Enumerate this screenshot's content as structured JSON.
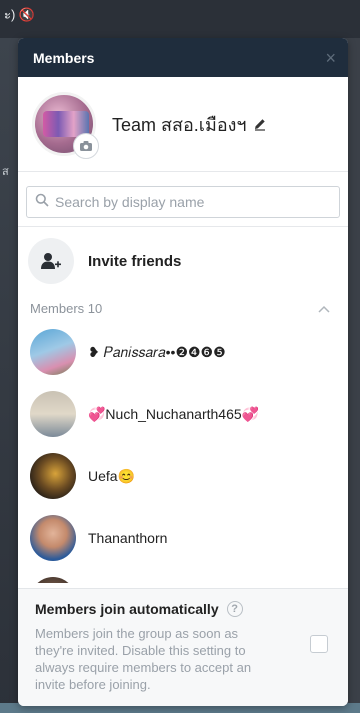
{
  "background": {
    "system_icons": "ะ) 🔇",
    "side_text": "ส"
  },
  "modal": {
    "title": "Members",
    "close_glyph": "×",
    "group": {
      "name": "Team สสอ.เมืองฯ"
    },
    "search": {
      "placeholder": "Search by display name",
      "value": ""
    },
    "invite": {
      "label": "Invite friends"
    },
    "members_header": "Members 10",
    "members": [
      {
        "name": "❥ 𝑃𝑎𝑛𝑖𝑠𝑠𝑎𝑟𝑎••❷❹❻❺",
        "avatar_colors": [
          "#5aa6d6",
          "#d98fb0"
        ]
      },
      {
        "name": "💞Nuch_Nuchanarth465💞",
        "avatar_colors": [
          "#c9c2b4",
          "#7c8a99"
        ]
      },
      {
        "name": "Uefa😊",
        "avatar_colors": [
          "#1e1a17",
          "#d8a33a"
        ]
      },
      {
        "name": "Thananthorn",
        "avatar_colors": [
          "#2b5a9a",
          "#e2b49a"
        ]
      },
      {
        "name": "",
        "avatar_colors": [
          "#3a2d27",
          "#8a6b55"
        ]
      }
    ],
    "auto_join": {
      "title": "Members join automatically",
      "help_glyph": "?",
      "description": "Members join the group as soon as they're invited. Disable this setting to always require members to accept an invite before joining.",
      "checked": false
    }
  }
}
